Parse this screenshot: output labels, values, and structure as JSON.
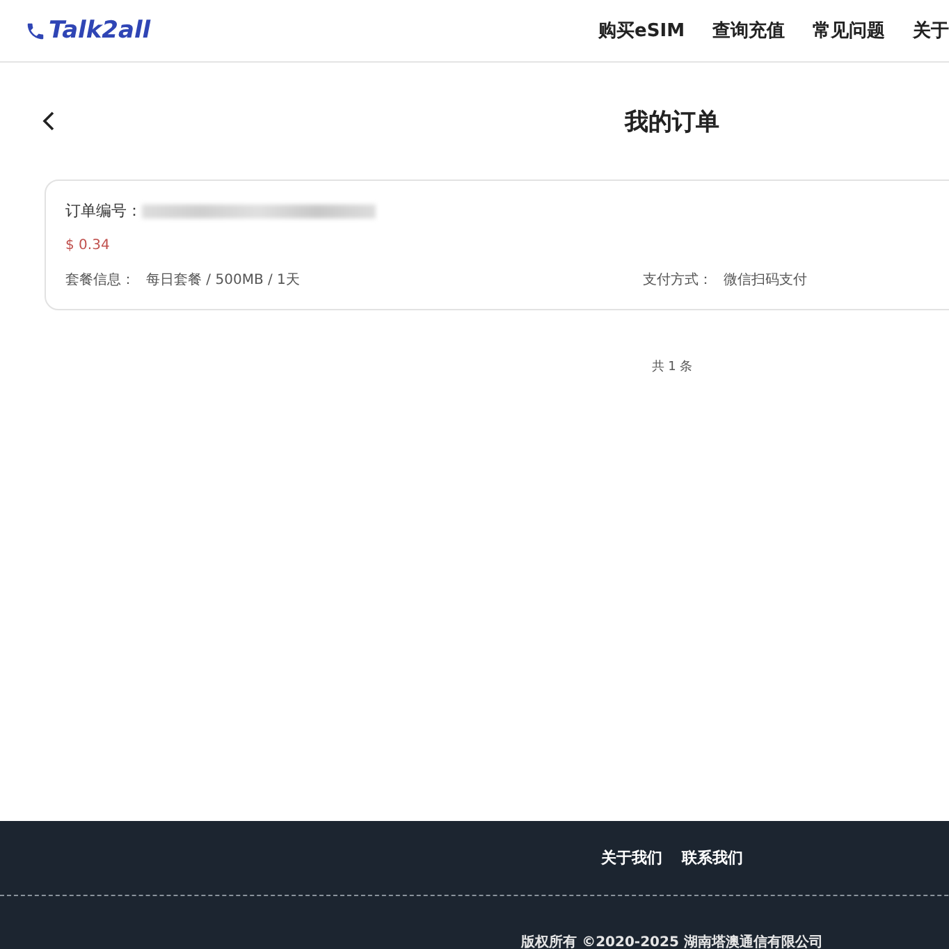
{
  "header": {
    "logo": "Talk2all",
    "nav": [
      "购买eSIM",
      "查询充值",
      "常见问题",
      "关于"
    ]
  },
  "page": {
    "title": "我的订单"
  },
  "orders": [
    {
      "number_label": "订单编号：",
      "price": "$ 0.34",
      "plan_label": "套餐信息：",
      "plan": "每日套餐 / 500MB / 1天",
      "payment_label": "支付方式：",
      "payment": "微信扫码支付"
    }
  ],
  "pagination": {
    "total": "共 1 条"
  },
  "footer": {
    "links": [
      "关于我们",
      "联系我们"
    ],
    "copyright": "版权所有 ©2020-2025 湖南塔澳通信有限公司"
  }
}
